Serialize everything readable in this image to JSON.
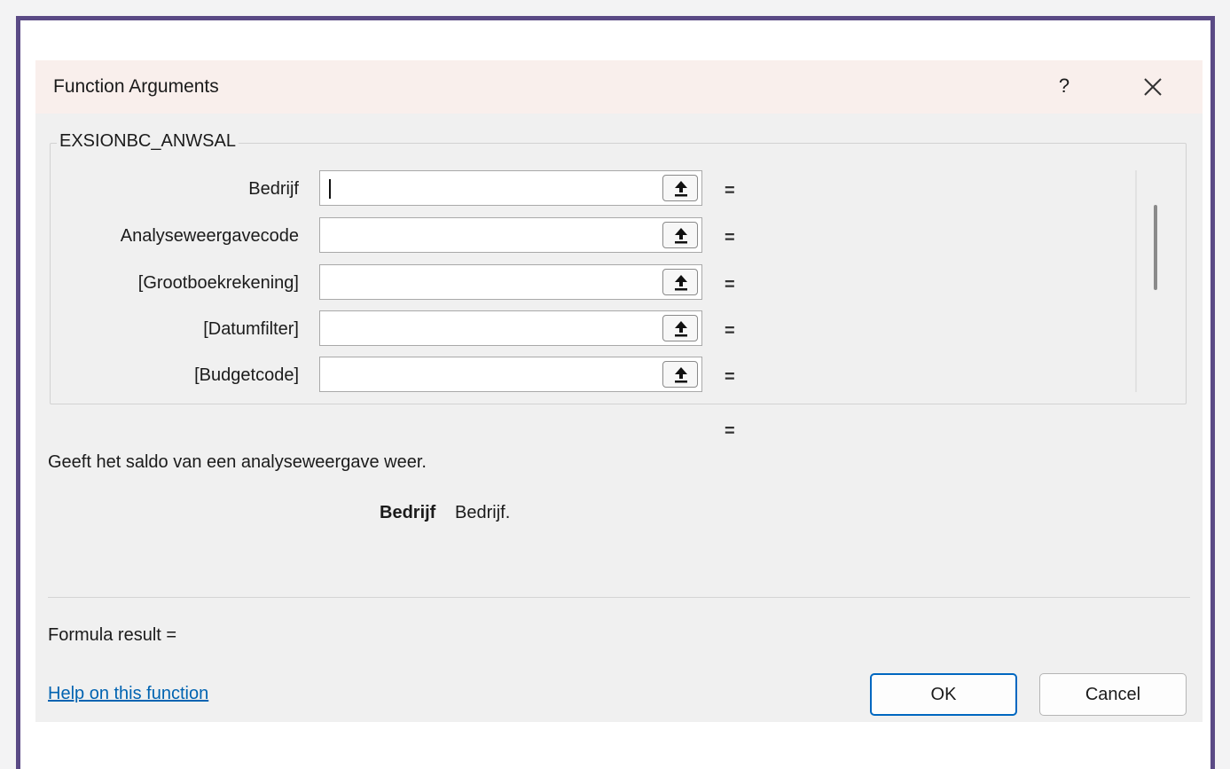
{
  "dialog": {
    "title": "Function Arguments",
    "help_button": "?",
    "close_icon": "close-icon"
  },
  "function": {
    "name": "EXSIONBC_ANWSAL",
    "arguments": [
      {
        "label": "Bedrijf",
        "value": ""
      },
      {
        "label": "Analyseweergavecode",
        "value": ""
      },
      {
        "label": "[Grootboekrekening]",
        "value": ""
      },
      {
        "label": "[Datumfilter]",
        "value": ""
      },
      {
        "label": "[Budgetcode]",
        "value": ""
      }
    ],
    "equals": "=",
    "result_equals": "=",
    "description": "Geeft het saldo van een analyseweergave weer.",
    "arg_desc_name": "Bedrijf",
    "arg_desc_text": "Bedrijf."
  },
  "footer": {
    "formula_result": "Formula result =",
    "help_link": "Help on this function",
    "ok_label": "OK",
    "cancel_label": "Cancel"
  },
  "colors": {
    "window_border": "#5a4a85",
    "titlebar": "#f9efec",
    "link": "#0063b1",
    "ok_border": "#0067c0"
  }
}
